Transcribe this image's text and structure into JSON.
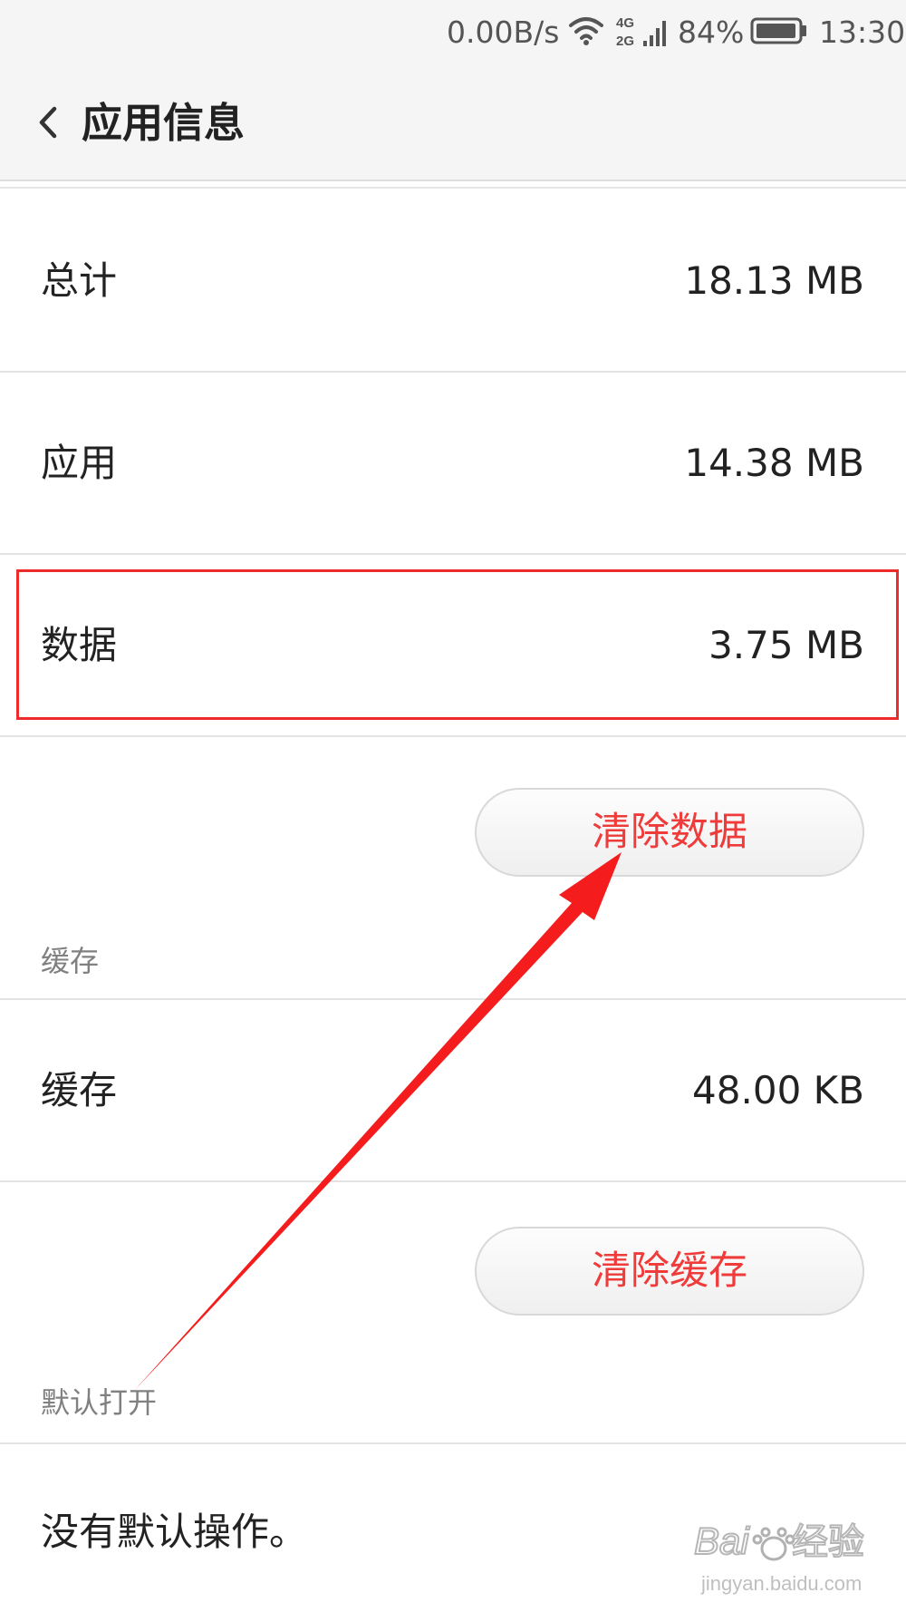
{
  "status_bar": {
    "net_speed": "0.00B/s",
    "network_4g": "4G",
    "network_2g": "2G",
    "battery_percent": "84%",
    "time": "13:30"
  },
  "header": {
    "back_icon": "chevron-left-icon",
    "title": "应用信息"
  },
  "storage": {
    "rows": [
      {
        "label": "总计",
        "value": "18.13 MB"
      },
      {
        "label": "应用",
        "value": "14.38 MB"
      },
      {
        "label": "数据",
        "value": "3.75 MB"
      }
    ],
    "clear_data_label": "清除数据"
  },
  "cache": {
    "section_title": "缓存",
    "row": {
      "label": "缓存",
      "value": "48.00 KB"
    },
    "clear_cache_label": "清除缓存"
  },
  "defaults": {
    "section_title": "默认打开",
    "message": "没有默认操作。"
  },
  "watermark": {
    "brand": "Baidu",
    "product": "经验",
    "url": "jingyan.baidu.com"
  },
  "colors": {
    "accent_red": "#f03b3b",
    "highlight_red": "#ee2a2a",
    "header_bg": "#f5f5f5"
  }
}
